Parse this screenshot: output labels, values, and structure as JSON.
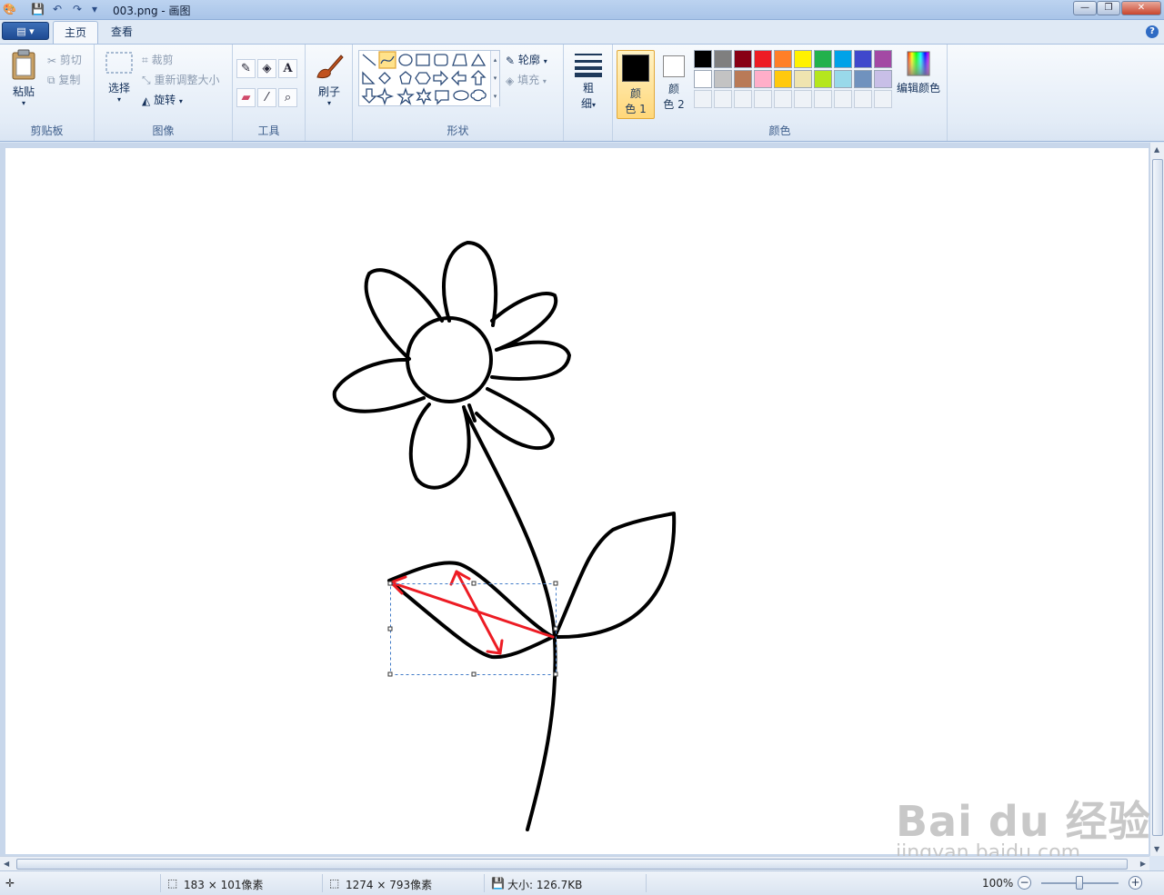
{
  "window": {
    "title": "003.png - 画图"
  },
  "menu": {
    "app_menu_label": "▤ ▾"
  },
  "tabs": [
    {
      "label": "主页"
    },
    {
      "label": "查看"
    }
  ],
  "clipboard": {
    "paste": "粘贴",
    "cut": "剪切",
    "copy": "复制",
    "group": "剪贴板"
  },
  "image": {
    "select": "选择",
    "crop": "裁剪",
    "resize": "重新调整大小",
    "rotate": "旋转",
    "group": "图像"
  },
  "tools": {
    "group": "工具"
  },
  "brushes": {
    "label": "刷子"
  },
  "shapes": {
    "outline": "轮廓",
    "fill": "填充",
    "group": "形状"
  },
  "size": {
    "label_top": "粗",
    "label_bottom": "细"
  },
  "colors": {
    "color1_top": "颜",
    "color1_bottom": "色 1",
    "color2_top": "颜",
    "color2_bottom": "色 2",
    "edit": "编辑颜色",
    "group": "颜色",
    "color1_value": "#000000",
    "color2_value": "#ffffff",
    "palette_row1": [
      "#000000",
      "#7f7f7f",
      "#880015",
      "#ed1c24",
      "#ff7f27",
      "#fff200",
      "#22b14c",
      "#00a2e8",
      "#3f48cc",
      "#a349a4"
    ],
    "palette_row2": [
      "#ffffff",
      "#c3c3c3",
      "#b97a57",
      "#ffaec9",
      "#ffc90e",
      "#efe4b0",
      "#b5e61d",
      "#99d9ea",
      "#7092be",
      "#c8bfe7"
    ]
  },
  "drawing": {
    "stroke_color": "#000000",
    "arrow_color": "#ed1c24"
  },
  "status": {
    "selection_size": "183 × 101像素",
    "image_size": "1274 × 793像素",
    "file_size": "大小: 126.7KB",
    "zoom": "100%"
  },
  "watermark": {
    "brand": "Bai du 经验",
    "url": "jingyan.baidu.com"
  }
}
